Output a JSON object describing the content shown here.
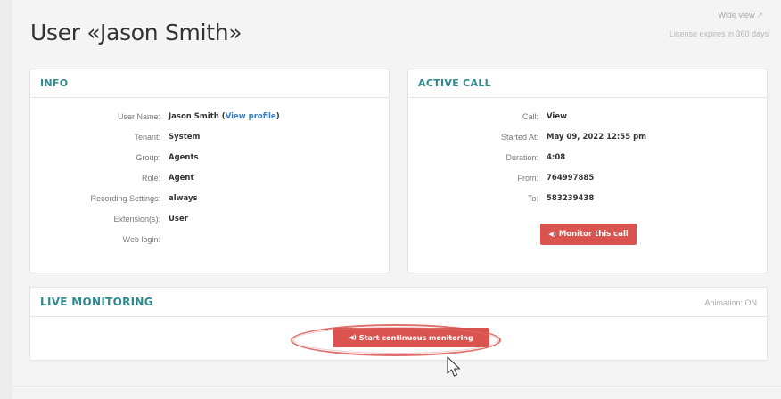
{
  "page": {
    "title": "User «Jason Smith»",
    "wide_view": "Wide view",
    "license": "License expires in 360 days"
  },
  "info": {
    "title": "INFO",
    "user_name_label": "User Name:",
    "user_name_value": "Jason Smith",
    "user_name_link_open": "(",
    "user_name_link": "View profile",
    "user_name_link_close": ")",
    "tenant_label": "Tenant:",
    "tenant_value": "System",
    "group_label": "Group:",
    "group_value": "Agents",
    "role_label": "Role:",
    "role_value": "Agent",
    "recording_label": "Recording Settings:",
    "recording_value": "always",
    "extension_label": "Extension(s):",
    "extension_value": "User",
    "weblogin_label": "Web login:"
  },
  "active_call": {
    "title": "ACTIVE CALL",
    "call_label": "Call:",
    "call_value": "View",
    "started_label": "Started At:",
    "started_value": "May 09, 2022 12:55 pm",
    "duration_label": "Duration:",
    "duration_value": "4:08",
    "from_label": "From:",
    "from_value": "764997885",
    "to_label": "To:",
    "to_value": "583239438",
    "monitor_button": "Monitor this call"
  },
  "live": {
    "title": "LIVE MONITORING",
    "animation": "Animation: ON",
    "start_button": "Start continuous monitoring"
  },
  "icons": {
    "speaker": "◀)",
    "expand": "↗"
  },
  "colors": {
    "accent_teal": "#2e8a8e",
    "button_red": "#d9534f",
    "link_blue": "#3a7fc1"
  }
}
